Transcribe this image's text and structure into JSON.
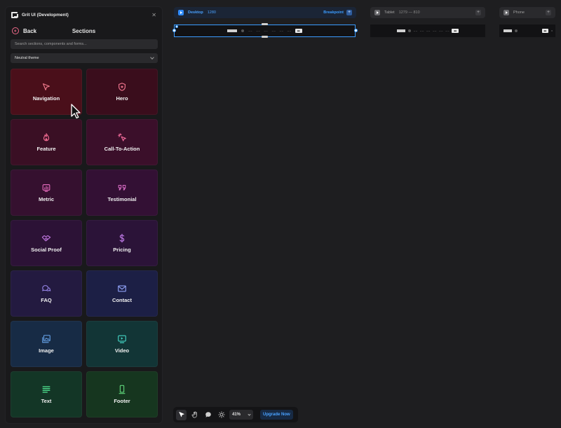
{
  "sidebar": {
    "app_title": "Grit UI (Development)",
    "back_label": "Back",
    "title": "Sections",
    "search_placeholder": "Search sections, components and forms...",
    "theme_value": "Neutral theme",
    "cards": [
      {
        "label": "Navigation",
        "icon": "cursor-arrow-icon",
        "bg": "#4a0f1a",
        "color": "#f07a8c"
      },
      {
        "label": "Hero",
        "icon": "shield-star-icon",
        "bg": "#3a0d1c",
        "color": "#f0758f"
      },
      {
        "label": "Feature",
        "icon": "flame-icon",
        "bg": "#3a0f24",
        "color": "#f06a90"
      },
      {
        "label": "Call-To-Action",
        "icon": "pointer-click-icon",
        "bg": "#3b0f2a",
        "color": "#f06a9a"
      },
      {
        "label": "Metric",
        "icon": "chart-icon",
        "bg": "#35102f",
        "color": "#e067b8"
      },
      {
        "label": "Testimonial",
        "icon": "quote-icon",
        "bg": "#331034",
        "color": "#d86cc4"
      },
      {
        "label": "Social Proof",
        "icon": "handshake-icon",
        "bg": "#2c1236",
        "color": "#c67ae6"
      },
      {
        "label": "Pricing",
        "icon": "dollar-icon",
        "bg": "#2b1338",
        "color": "#c07ae8"
      },
      {
        "label": "FAQ",
        "icon": "chat-bubbles-icon",
        "bg": "#231a40",
        "color": "#9c8af0"
      },
      {
        "label": "Contact",
        "icon": "envelope-icon",
        "bg": "#1c1f45",
        "color": "#8ea0f5"
      },
      {
        "label": "Image",
        "icon": "image-icon",
        "bg": "#172b45",
        "color": "#6aa8f0"
      },
      {
        "label": "Video",
        "icon": "video-icon",
        "bg": "#123536",
        "color": "#44d3c4"
      },
      {
        "label": "Text",
        "icon": "text-lines-icon",
        "bg": "#133626",
        "color": "#4cd98a"
      },
      {
        "label": "Footer",
        "icon": "phone-device-icon",
        "bg": "#16361f",
        "color": "#5ed47a"
      }
    ]
  },
  "breakpoints": [
    {
      "name": "Desktop",
      "size": "1280",
      "link": "Breakpoint",
      "name_color": "#4aa2ff",
      "bar_bg": "#1b2536",
      "play_bg": "#2f8cff"
    },
    {
      "name": "Tablet",
      "size": "1279 — 810",
      "bar_bg": "#2a2a2d",
      "play_bg": "#6a6a6e"
    },
    {
      "name": "Phone",
      "size": "",
      "bar_bg": "#2a2a2d",
      "play_bg": "#6a6a6e"
    }
  ],
  "toolbar": {
    "zoom": "41%",
    "upgrade_label": "Upgrade Now",
    "tools": [
      "select-arrow-icon",
      "hand-icon",
      "comment-icon",
      "sun-icon"
    ]
  }
}
